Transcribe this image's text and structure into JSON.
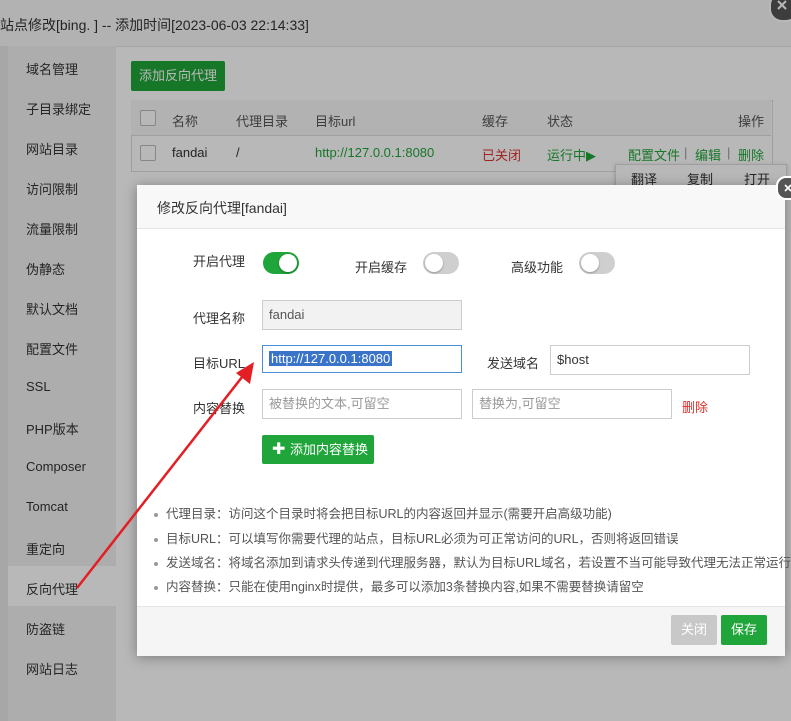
{
  "outer": {
    "title": "站点修改[bing.           ] -- 添加时间[2023-06-03 22:14:33]"
  },
  "sidebar": {
    "items": [
      {
        "label": "域名管理"
      },
      {
        "label": "子目录绑定"
      },
      {
        "label": "网站目录"
      },
      {
        "label": "访问限制"
      },
      {
        "label": "流量限制"
      },
      {
        "label": "伪静态"
      },
      {
        "label": "默认文档"
      },
      {
        "label": "配置文件"
      },
      {
        "label": "SSL"
      },
      {
        "label": "PHP版本"
      },
      {
        "label": "Composer"
      },
      {
        "label": "Tomcat"
      },
      {
        "label": "重定向"
      },
      {
        "label": "反向代理"
      },
      {
        "label": "防盗链"
      },
      {
        "label": "网站日志"
      }
    ],
    "active": "反向代理"
  },
  "toolbar": {
    "add_proxy_label": "添加反向代理"
  },
  "table": {
    "headers": {
      "name": "名称",
      "dir": "代理目录",
      "url": "目标url",
      "cache": "缓存",
      "status": "状态",
      "actions": "操作"
    },
    "rows": [
      {
        "name": "fandai",
        "dir": "/",
        "url": "http://127.0.0.1:8080",
        "cache": "已关闭",
        "status": "运行中▶",
        "config": "配置文件",
        "edit": "编辑",
        "delete": "删除",
        "sep1": "|",
        "sep2": "|"
      }
    ]
  },
  "context_menu": {
    "translate": "翻译",
    "copy": "复制",
    "open": "打开"
  },
  "modal": {
    "title": "修改反向代理[fandai]",
    "enable_proxy_label": "开启代理",
    "enable_cache_label": "开启缓存",
    "advanced_label": "高级功能",
    "enable_proxy": true,
    "enable_cache": false,
    "advanced": false,
    "proxy_name_label": "代理名称",
    "proxy_name_value": "fandai",
    "target_url_label": "目标URL",
    "target_url_value": "http://127.0.0.1:8080",
    "send_domain_label": "发送域名",
    "send_domain_value": "$host",
    "content_replace_label": "内容替换",
    "replace_from_placeholder": "被替换的文本,可留空",
    "replace_to_placeholder": "替换为,可留空",
    "delete_label": "删除",
    "add_rule_label": "添加内容替换",
    "tips": [
      "代理目录：访问这个目录时将会把目标URL的内容返回并显示(需要开启高级功能)",
      "目标URL：可以填写你需要代理的站点，目标URL必须为可正常访问的URL，否则将返回错误",
      "发送域名：将域名添加到请求头传递到代理服务器，默认为目标URL域名，若设置不当可能导致代理无法正常运行",
      "内容替换：只能在使用nginx时提供，最多可以添加3条替换内容,如果不需要替换请留空"
    ],
    "close_label": "关闭",
    "save_label": "保存"
  },
  "colors": {
    "accent": "#20a53a",
    "danger": "#e0302b",
    "selection": "#3a74c9",
    "annotation_arrow": "#e31e24"
  }
}
